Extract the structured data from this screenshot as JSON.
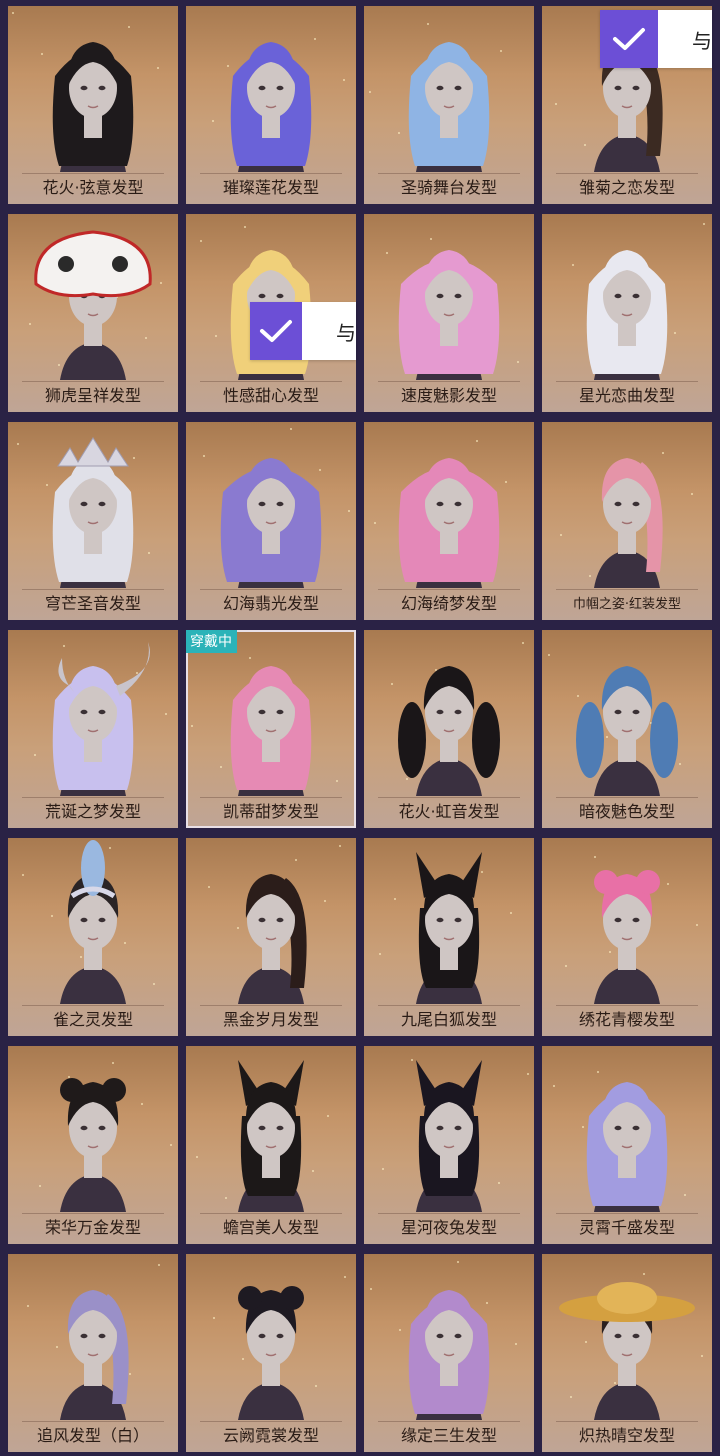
{
  "worn_badge": "穿戴中",
  "select_tag_text": "与",
  "cards": [
    {
      "name": "花火·弦意发型",
      "hair": "#1e1a1c",
      "style": "long"
    },
    {
      "name": "璀璨莲花发型",
      "hair": "#6a62d8",
      "style": "long"
    },
    {
      "name": "圣骑舞台发型",
      "hair": "#8fb4e4",
      "style": "long"
    },
    {
      "name": "雏菊之恋发型",
      "hair": "#3b2a22",
      "style": "pony"
    },
    {
      "name": "狮虎呈祥发型",
      "hair": "#f2f0ee",
      "style": "lion"
    },
    {
      "name": "性感甜心发型",
      "hair": "#f0d07a",
      "style": "long"
    },
    {
      "name": "速度魅影发型",
      "hair": "#e59ad0",
      "style": "curly"
    },
    {
      "name": "星光恋曲发型",
      "hair": "#e8e8f0",
      "style": "long"
    },
    {
      "name": "穹芒圣音发型",
      "hair": "#e0e0e8",
      "style": "crown"
    },
    {
      "name": "幻海翡光发型",
      "hair": "#8a7ad0",
      "style": "curly"
    },
    {
      "name": "幻海绮梦发型",
      "hair": "#e488b8",
      "style": "curly"
    },
    {
      "name": "巾帼之姿·红装发型",
      "hair": "#e594a8",
      "style": "pony"
    },
    {
      "name": "荒诞之梦发型",
      "hair": "#c8c0ee",
      "style": "horn"
    },
    {
      "name": "凯蒂甜梦发型",
      "hair": "#e68ab4",
      "style": "long"
    },
    {
      "name": "花火·虹音发型",
      "hair": "#1a1618",
      "style": "twin"
    },
    {
      "name": "暗夜魅色发型",
      "hair": "#4f7cb4",
      "style": "twin"
    },
    {
      "name": "雀之灵发型",
      "hair": "#2a2426",
      "style": "feather"
    },
    {
      "name": "黑金岁月发型",
      "hair": "#2b1d1a",
      "style": "pony"
    },
    {
      "name": "九尾白狐发型",
      "hair": "#1a1618",
      "style": "ears"
    },
    {
      "name": "绣花青樱发型",
      "hair": "#e870a6",
      "style": "bun"
    },
    {
      "name": "荣华万金发型",
      "hair": "#1f1a1a",
      "style": "bun"
    },
    {
      "name": "蟾宫美人发型",
      "hair": "#1c1818",
      "style": "ears"
    },
    {
      "name": "星河夜兔发型",
      "hair": "#1a1620",
      "style": "ears"
    },
    {
      "name": "灵霄千盛发型",
      "hair": "#a29ce0",
      "style": "long"
    },
    {
      "name": "追风发型（白）",
      "hair": "#9a90c8",
      "style": "pony"
    },
    {
      "name": "云阙霓裳发型",
      "hair": "#1e1a22",
      "style": "bun"
    },
    {
      "name": "缘定三生发型",
      "hair": "#b28acc",
      "style": "long"
    },
    {
      "name": "炽热晴空发型",
      "hair": "#2a2020",
      "style": "hat"
    }
  ]
}
